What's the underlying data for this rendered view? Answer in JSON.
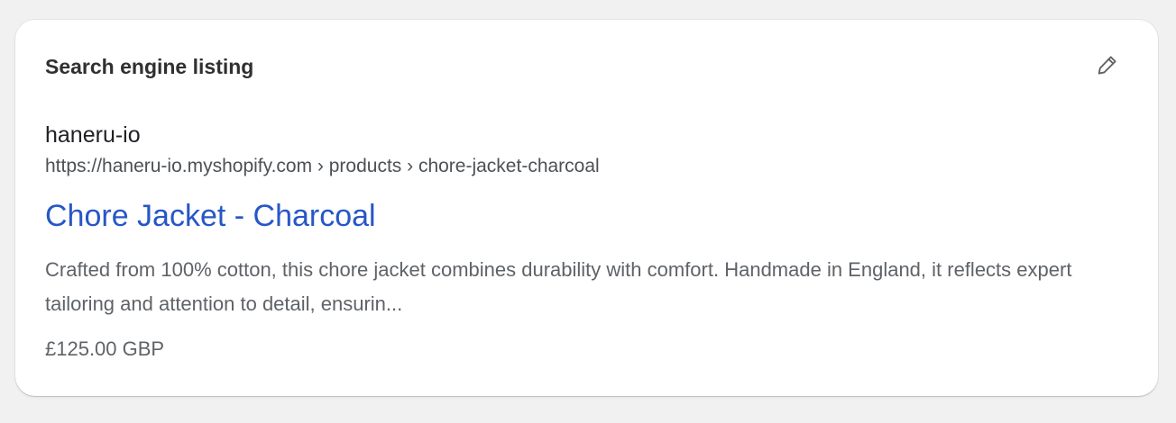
{
  "card": {
    "title": "Search engine listing",
    "edit_icon": "pencil-icon"
  },
  "listing": {
    "site_name": "haneru-io",
    "url": "https://haneru-io.myshopify.com › products › chore-jacket-charcoal",
    "title": "Chore Jacket - Charcoal",
    "description": "Crafted from 100% cotton, this chore jacket combines durability with comfort. Handmade in England, it reflects expert tailoring and attention to detail, ensurin...",
    "price": "£125.00 GBP"
  },
  "colors": {
    "link": "#2657c6",
    "background": "#f1f1f1",
    "card": "#ffffff"
  }
}
